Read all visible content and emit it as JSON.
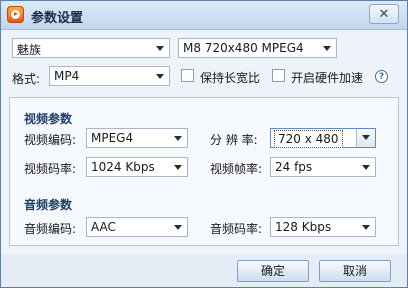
{
  "window": {
    "title": "参数设置",
    "close_symbol": "✕"
  },
  "top": {
    "device": "魅族",
    "preset": "M8 720x480 MPEG4",
    "format_label": "格式:",
    "format": "MP4",
    "keep_aspect_label": "保持长宽比",
    "keep_aspect_checked": false,
    "hw_accel_label": "开启硬件加速",
    "hw_accel_checked": false,
    "help_symbol": "?"
  },
  "video": {
    "section_title": "视频参数",
    "codec_label": "视频编码:",
    "codec": "MPEG4",
    "resolution_label": "分 辨 率:",
    "resolution": "720 x 480",
    "bitrate_label": "视频码率:",
    "bitrate": "1024 Kbps",
    "framerate_label": "视频帧率:",
    "framerate": "24 fps"
  },
  "audio": {
    "section_title": "音频参数",
    "codec_label": "音频编码:",
    "codec": "AAC",
    "bitrate_label": "音频码率:",
    "bitrate": "128 Kbps"
  },
  "buttons": {
    "ok": "确定",
    "cancel": "取消"
  },
  "colors": {
    "titlebar": "#c3d6ee",
    "panel_bg": "#f5f8fc",
    "section_title": "#1f3f6a",
    "help": "#3d6fb5",
    "border": "#5d7fa8"
  },
  "icons": {
    "app": "app-logo-icon",
    "close": "close-icon",
    "help": "help-icon",
    "dropdown": "chevron-down-icon"
  }
}
